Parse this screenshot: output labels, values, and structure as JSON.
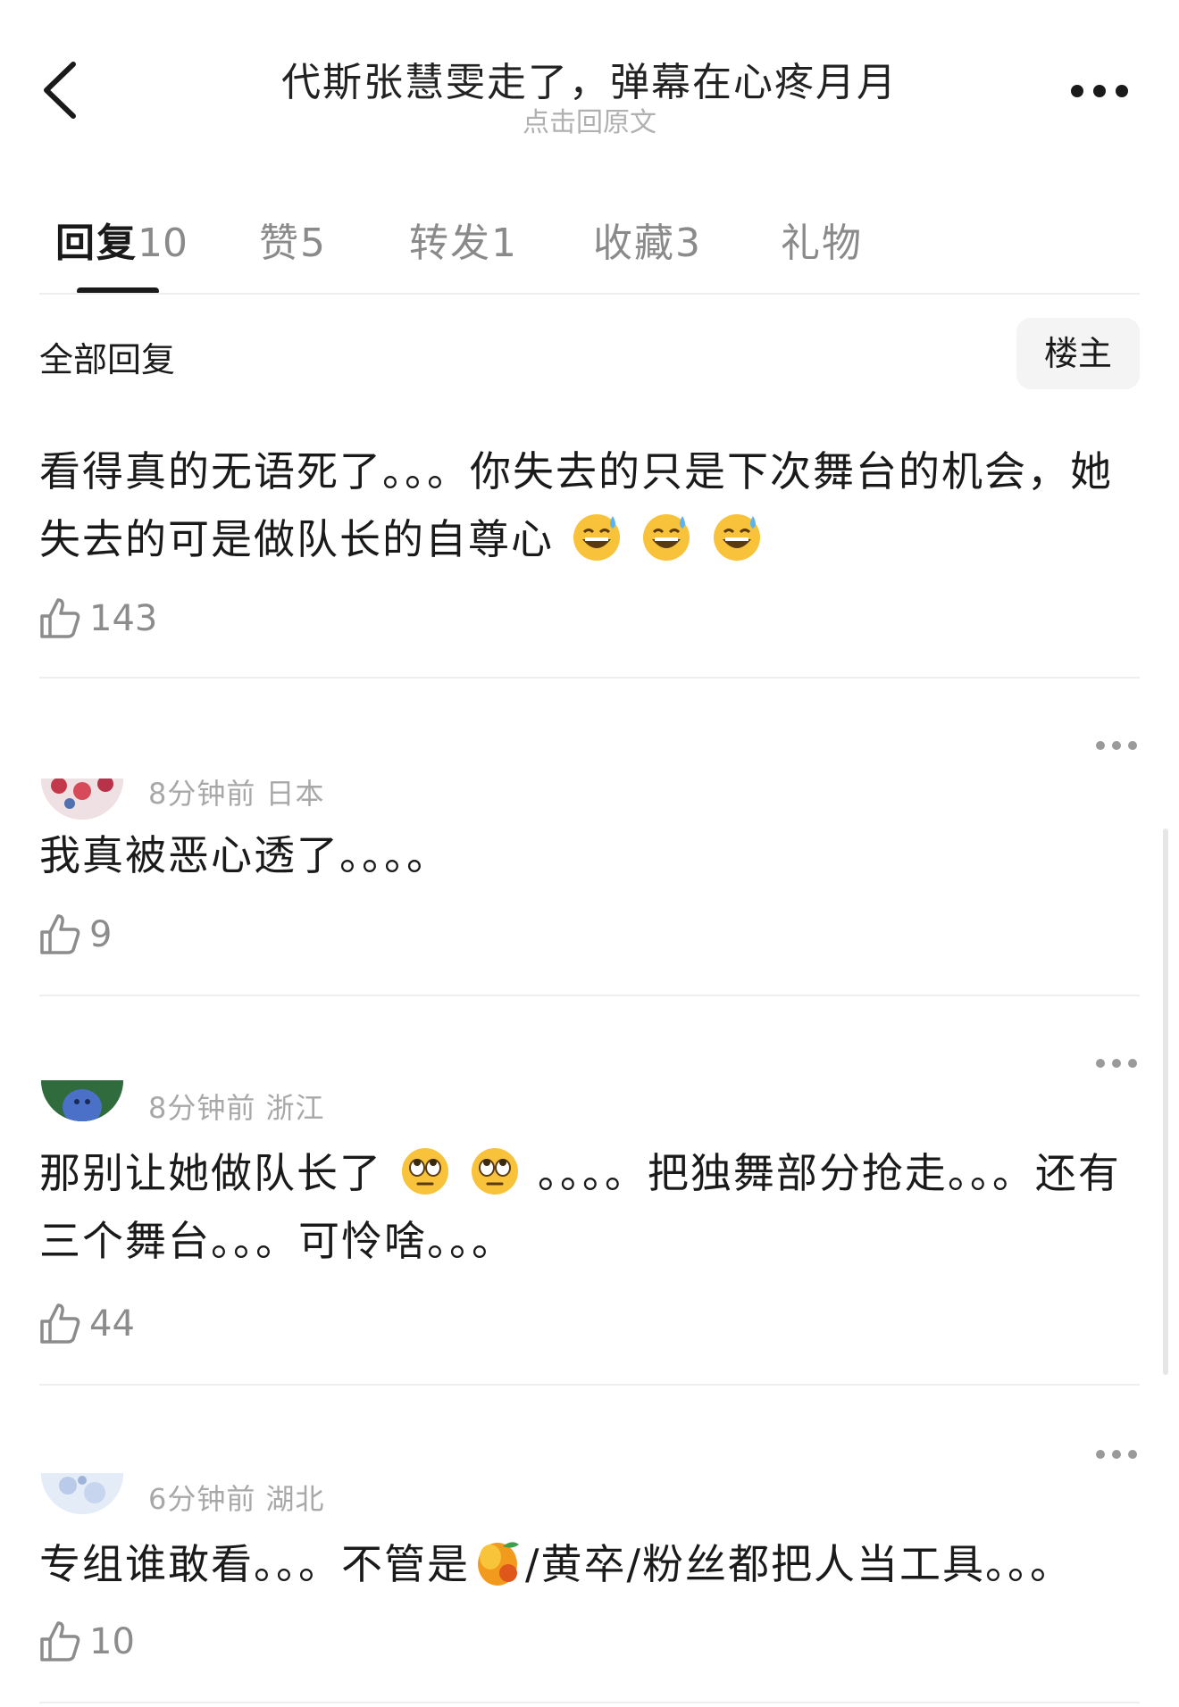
{
  "header": {
    "back_icon": "chevron-left-icon",
    "title": "代斯张慧雯走了，弹幕在心疼月月",
    "subtitle": "点击回原文",
    "more_icon": "more-horizontal-icon"
  },
  "tabs": [
    {
      "label": "回复",
      "count": "10",
      "active": true
    },
    {
      "label": "赞",
      "count": "5"
    },
    {
      "label": "转发",
      "count": "1"
    },
    {
      "label": "收藏",
      "count": "3"
    },
    {
      "label": "礼物",
      "count": ""
    }
  ],
  "section": {
    "title": "全部回复",
    "op_button": "楼主"
  },
  "comments": [
    {
      "meta": "",
      "text_parts": [
        "看得真的无语死了。。。你失去的只是下次舞台的机会，她失去的可是做队长的自尊心"
      ],
      "emojis": [
        "sweat-smile-emoji",
        "sweat-smile-emoji",
        "sweat-smile-emoji"
      ],
      "likes": "143"
    },
    {
      "meta": "8分钟前 日本",
      "text_parts": [
        "我真被恶心透了。。。。"
      ],
      "likes": "9"
    },
    {
      "meta": "8分钟前 浙江",
      "text_parts": [
        "那别让她做队长了",
        "。。。。把独舞部分抢走。。。还有三个舞台。。。可怜啥。。。"
      ],
      "emojis": [
        "eye-roll-emoji",
        "eye-roll-emoji"
      ],
      "likes": "44"
    },
    {
      "meta": "6分钟前 湖北",
      "text_parts": [
        "专组谁敢看。。。不管是",
        "/黄卒/粉丝都把人当工具。。。"
      ],
      "emojis": [
        "mango-emoji"
      ],
      "likes": "10"
    }
  ],
  "icons": {
    "like": "thumbs-up-icon",
    "comment_more": "more-horizontal-icon"
  },
  "colors": {
    "text": "#1a1a1a",
    "secondary": "#8a8a8a",
    "meta": "#a8a8a8",
    "divider": "#eeeeee"
  }
}
